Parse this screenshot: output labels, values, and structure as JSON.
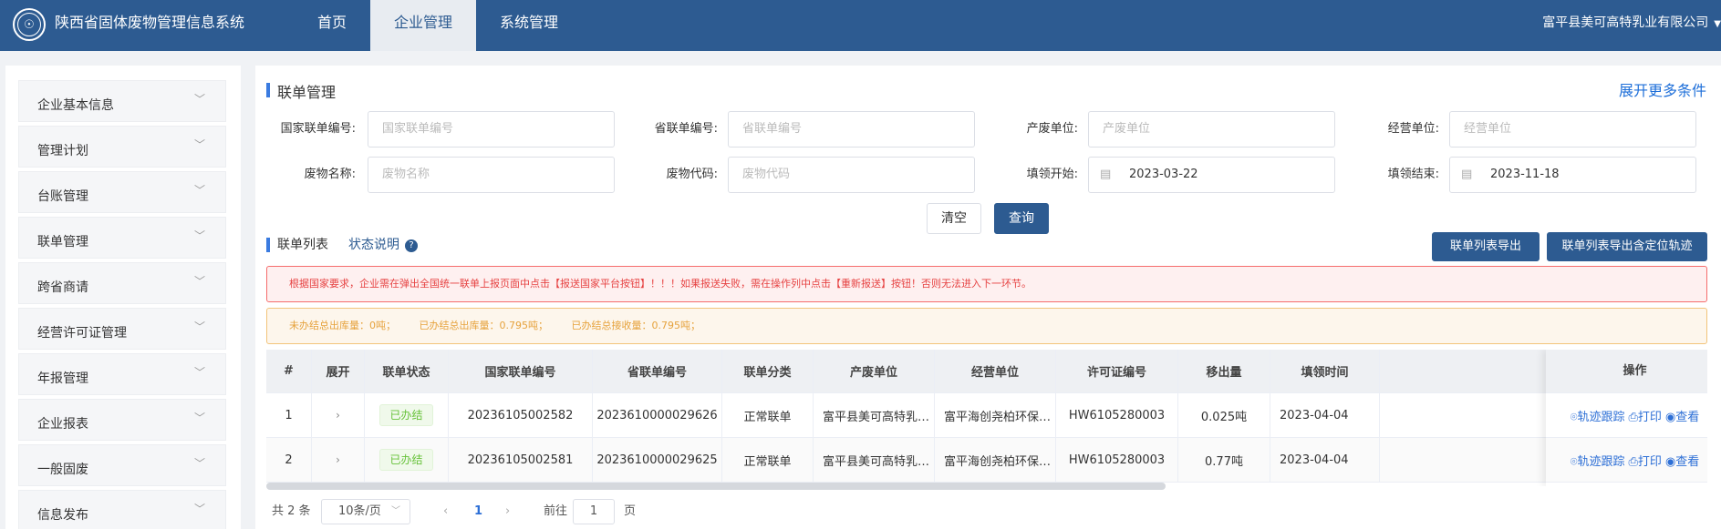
{
  "app": {
    "title": "陕西省固体废物管理信息系统",
    "logo_glyph": "☉",
    "nav": [
      "首页",
      "企业管理",
      "系统管理"
    ],
    "active_nav": 1,
    "user": "富平县美可高特乳业有限公司",
    "colors": {
      "brand": "#2d5b91",
      "link": "#1e6fd9",
      "success": "#67c23a",
      "error": "#e64242",
      "warning": "#e6a23c"
    }
  },
  "sidebar": {
    "items": [
      "企业基本信息",
      "管理计划",
      "台账管理",
      "联单管理",
      "跨省商请",
      "经营许可证管理",
      "年报管理",
      "企业报表",
      "一般固废",
      "信息发布"
    ]
  },
  "search": {
    "title": "联单管理",
    "more_link": "展开更多条件",
    "fields": [
      {
        "label": "国家联单编号:",
        "placeholder": "国家联单编号",
        "value": ""
      },
      {
        "label": "省联单编号:",
        "placeholder": "省联单编号",
        "value": ""
      },
      {
        "label": "产废单位:",
        "placeholder": "产废单位",
        "value": ""
      },
      {
        "label": "经营单位:",
        "placeholder": "经营单位",
        "value": ""
      },
      {
        "label": "废物名称:",
        "placeholder": "废物名称",
        "value": ""
      },
      {
        "label": "废物代码:",
        "placeholder": "废物代码",
        "value": ""
      },
      {
        "label": "填领开始:",
        "placeholder": "",
        "value": "2023-03-22"
      },
      {
        "label": "填领结束:",
        "placeholder": "",
        "value": "2023-11-18"
      }
    ],
    "clear_label": "清空",
    "query_label": "查询"
  },
  "list": {
    "title": "联单列表",
    "status_link": "状态说明",
    "help_glyph": "?",
    "export_label": "联单列表导出",
    "export_track_label": "联单列表导出含定位轨迹",
    "alert_error": "根据国家要求，企业需在弹出全国统一联单上报页面中点击【报送国家平台按钮】！！！如果报送失败，需在操作列中点击【重新报送】按钮！否则无法进入下一环节。",
    "summary": {
      "pending": "未办结总出库量：0吨；",
      "done_out": "已办结总出库量：0.795吨；",
      "done_in": "已办结总接收量：0.795吨；"
    },
    "columns": [
      "#",
      "展开",
      "联单状态",
      "国家联单编号",
      "省联单编号",
      "联单分类",
      "产废单位",
      "经营单位",
      "许可证编号",
      "移出量",
      "填领时间",
      "操作"
    ],
    "rows": [
      {
        "index": "1",
        "status": "已办结",
        "national_no": "20236105002582",
        "province_no": "2023610000029626",
        "category": "正常联单",
        "producer": "富平县美可高特乳…",
        "operator": "富平海创尧柏环保…",
        "license": "HW6105280003",
        "amount": "0.025吨",
        "date": "2023-04-04"
      },
      {
        "index": "2",
        "status": "已办结",
        "national_no": "20236105002581",
        "province_no": "2023610000029625",
        "category": "正常联单",
        "producer": "富平县美可高特乳…",
        "operator": "富平海创尧柏环保…",
        "license": "HW6105280003",
        "amount": "0.77吨",
        "date": "2023-04-04"
      }
    ],
    "actions": [
      {
        "icon": "location-pin-icon",
        "glyph": "⌾",
        "label": "轨迹跟踪"
      },
      {
        "icon": "printer-icon",
        "glyph": "⎙",
        "label": "打印"
      },
      {
        "icon": "eye-icon",
        "glyph": "◉",
        "label": "查看"
      }
    ],
    "expand_glyph": "›"
  },
  "pagination": {
    "total": "共 2 条",
    "page_size": "10条/页",
    "current": "1",
    "goto_label": "前往",
    "goto_value": "1",
    "unit": "页",
    "prev_glyph": "‹",
    "next_glyph": "›"
  }
}
